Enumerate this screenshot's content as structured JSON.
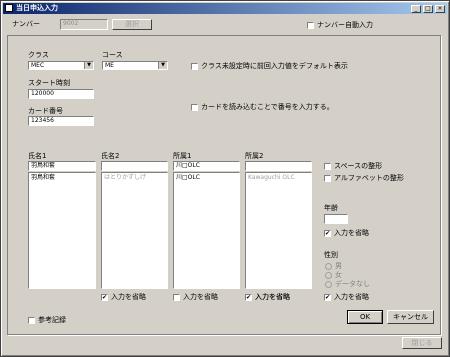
{
  "window": {
    "title": "当日申込入力"
  },
  "number": {
    "label": "ナンバー",
    "value": "9002",
    "lookup_button": "選択",
    "auto_label": "ナンバー自動入力"
  },
  "class": {
    "label": "クラス",
    "selected": "MEC"
  },
  "course": {
    "label": "コース",
    "selected": "ME"
  },
  "class_default_option": "クラス未設定時に前回入力値をデフォルト表示",
  "start_time": {
    "label": "スタート時刻",
    "value": "120000"
  },
  "card": {
    "label": "カード番号",
    "value": "123456",
    "read_option": "カードを読み込むことで番号を入力する。"
  },
  "name1": {
    "label": "氏名1",
    "value": "羽鳥和套",
    "list": [
      "羽鳥和套"
    ],
    "omit_label": "入力を省略",
    "omit_checked": true
  },
  "name2": {
    "label": "氏名2",
    "value": "",
    "list": [
      "はとりかずしげ"
    ],
    "omit_label": "入力を省略",
    "omit_checked": false
  },
  "affil1": {
    "label": "所属1",
    "value": "川□OLC",
    "list": [
      "川□OLC"
    ],
    "omit_label": "入力を省略",
    "omit_checked": false
  },
  "affil2": {
    "label": "所属2",
    "value": "",
    "list": [
      "Kawaguchi OLC"
    ],
    "omit_label": "入力を省略",
    "omit_checked": true
  },
  "format": {
    "space_label": "スペースの整形",
    "alpha_label": "アルファベットの整形"
  },
  "age": {
    "label": "年齢",
    "value": "",
    "omit_label": "入力を省略",
    "omit_checked": true
  },
  "gender": {
    "label": "性別",
    "options": [
      "男",
      "女",
      "データなし"
    ],
    "omit_label": "入力を省略",
    "omit_checked": true
  },
  "reference_label": "参考記録",
  "buttons": {
    "ok": "OK",
    "cancel": "キャンセル",
    "close": "閉じる"
  }
}
